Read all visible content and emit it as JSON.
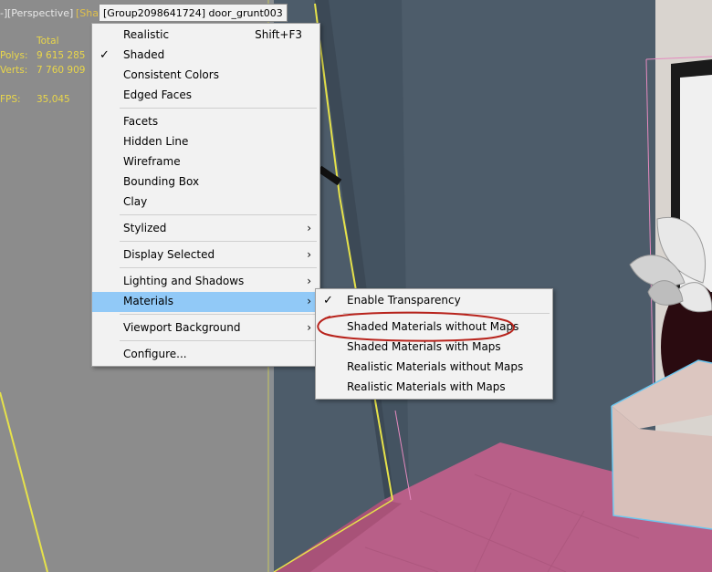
{
  "viewport": {
    "label_left": "-]",
    "label_view": "[Perspective]",
    "label_shading": "[Sha",
    "selected_object": "[Group2098641724] door_grunt003"
  },
  "stats": {
    "total_header": "Total",
    "polys_label": "Polys:",
    "polys_value": "9 615 285",
    "verts_label": "Verts:",
    "verts_value": "7 760 909",
    "fps_label": "FPS:",
    "fps_value": "35,045"
  },
  "menu": {
    "items": [
      {
        "label": "Realistic",
        "shortcut": "Shift+F3",
        "checked": false,
        "submenu": false
      },
      {
        "label": "Shaded",
        "shortcut": "",
        "checked": true,
        "submenu": false
      },
      {
        "label": "Consistent Colors",
        "shortcut": "",
        "checked": false,
        "submenu": false
      },
      {
        "label": "Edged Faces",
        "shortcut": "",
        "checked": false,
        "submenu": false
      },
      {
        "label": "Facets",
        "shortcut": "",
        "checked": false,
        "submenu": false
      },
      {
        "label": "Hidden Line",
        "shortcut": "",
        "checked": false,
        "submenu": false
      },
      {
        "label": "Wireframe",
        "shortcut": "",
        "checked": false,
        "submenu": false
      },
      {
        "label": "Bounding Box",
        "shortcut": "",
        "checked": false,
        "submenu": false
      },
      {
        "label": "Clay",
        "shortcut": "",
        "checked": false,
        "submenu": false
      },
      {
        "label": "Stylized",
        "shortcut": "",
        "checked": false,
        "submenu": true
      },
      {
        "label": "Display Selected",
        "shortcut": "",
        "checked": false,
        "submenu": true
      },
      {
        "label": "Lighting and Shadows",
        "shortcut": "",
        "checked": false,
        "submenu": true
      },
      {
        "label": "Materials",
        "shortcut": "",
        "checked": false,
        "submenu": true,
        "highlighted": true
      },
      {
        "label": "Viewport Background",
        "shortcut": "",
        "checked": false,
        "submenu": true
      },
      {
        "label": "Configure...",
        "shortcut": "",
        "checked": false,
        "submenu": false
      }
    ],
    "check_glyph": "✓",
    "arrow_glyph": "›"
  },
  "submenu": {
    "items": [
      {
        "label": "Enable Transparency",
        "checked": true
      },
      {
        "label": "Shaded Materials without Maps",
        "checked": false,
        "annotated": true
      },
      {
        "label": "Shaded Materials with Maps",
        "checked": false
      },
      {
        "label": "Realistic Materials without Maps",
        "checked": false
      },
      {
        "label": "Realistic Materials with Maps",
        "checked": false
      }
    ]
  },
  "colors": {
    "menu_highlight": "#91c9f7",
    "stat_text": "#e9d64a",
    "annotation_circle": "#b8231c",
    "selection_outline": "#e6e24a",
    "floor": "#b85f88"
  },
  "icons": {
    "check": "checkmark-icon",
    "submenu_arrow": "chevron-right-icon"
  }
}
